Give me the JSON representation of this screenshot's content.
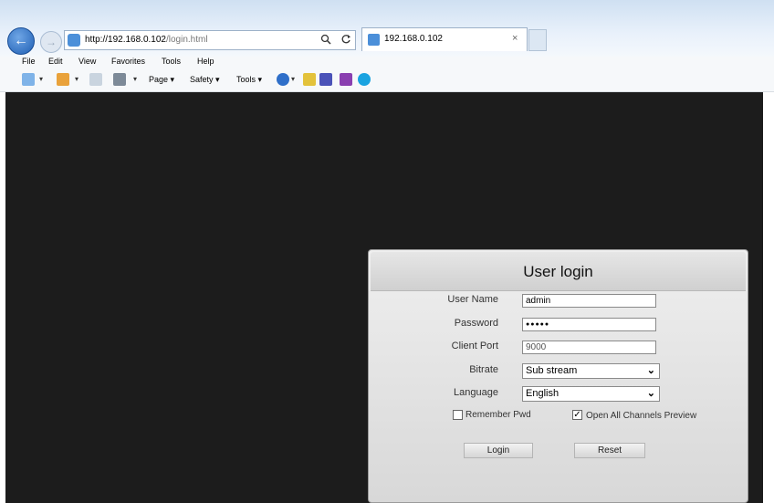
{
  "browser": {
    "address": {
      "host": "http://192.168.0.102",
      "path": "/login.html"
    },
    "search_icon": "search-icon",
    "refresh_icon": "refresh-icon",
    "tab": {
      "title": "192.168.0.102",
      "close": "×"
    },
    "back_glyph": "←",
    "forward_glyph": "→"
  },
  "menu": [
    "File",
    "Edit",
    "View",
    "Favorites",
    "Tools",
    "Help"
  ],
  "toolbar": {
    "page": "Page",
    "safety": "Safety",
    "tools": "Tools",
    "arrow": "▾"
  },
  "login": {
    "title": "User login",
    "user_name_label": "User Name",
    "user_name_value": "admin",
    "password_label": "Password",
    "password_value": "●●●●●",
    "client_port_label": "Client Port",
    "client_port_value": "9000",
    "bitrate_label": "Bitrate",
    "bitrate_value": "Sub stream",
    "language_label": "Language",
    "language_value": "English",
    "remember_label": "Remember Pwd",
    "remember_checked": false,
    "preview_label": "Open All Channels Preview",
    "preview_checked": true,
    "check_glyph": "✓",
    "chevron": "⌄",
    "login_button": "Login",
    "reset_button": "Reset"
  },
  "colors": {
    "page_bg": "#1c1c1c",
    "dialog_bg": "#dedede",
    "accent": "#1f5fb4"
  }
}
